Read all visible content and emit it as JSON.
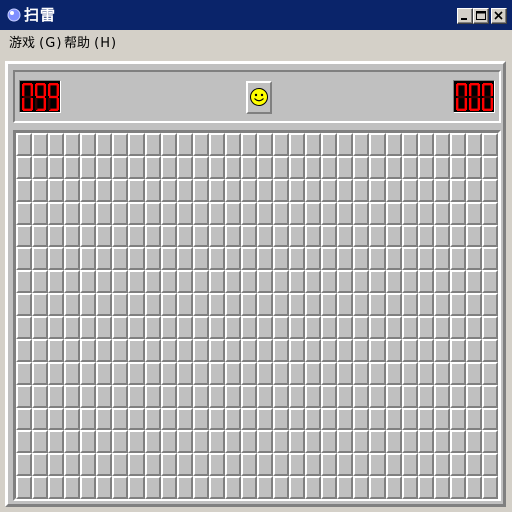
{
  "window": {
    "title": "扫雷",
    "icon": "minesweeper-mine-icon",
    "controls": [
      "minimize",
      "maximize",
      "close"
    ]
  },
  "menu": [
    {
      "label": "游戏",
      "mnemonic": "G"
    },
    {
      "label": "帮助",
      "mnemonic": "H"
    }
  ],
  "status": {
    "mines_remaining": "099",
    "timer": "000",
    "face": "smiley-face-icon"
  },
  "board": {
    "rows": 16,
    "cols": 30,
    "state": "all-covered"
  },
  "colors": {
    "titlebar": "#0a246a",
    "lcd_background": "#000000",
    "lcd_digit": "#ff0000",
    "face_yellow": "#ffff00",
    "cell_face": "#c0c0c0"
  }
}
